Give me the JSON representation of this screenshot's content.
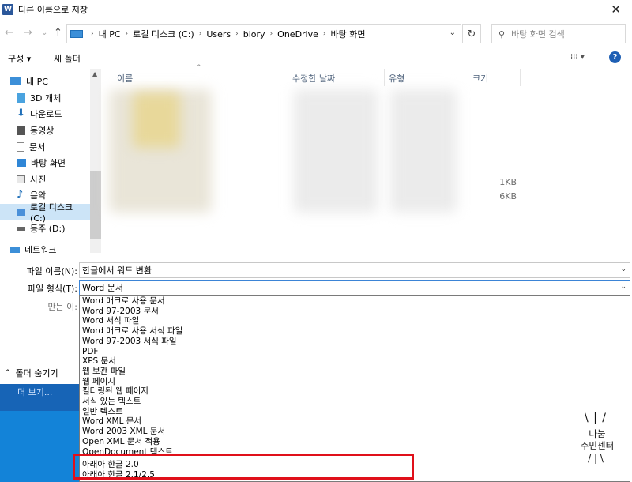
{
  "window": {
    "title": "다른 이름으로 저장",
    "app_icon": "W",
    "close": "✕"
  },
  "nav": {
    "back": "←",
    "forward": "→",
    "recent": "⌄",
    "up": "↑"
  },
  "address": {
    "crumbs": [
      "내 PC",
      "로컬 디스크 (C:)",
      "Users",
      "blory",
      "OneDrive",
      "바탕 화면"
    ],
    "dropdown": "⌄",
    "refresh": "↻"
  },
  "search": {
    "placeholder": "바탕 화면 검색"
  },
  "toolbar": {
    "organize": "구성 ▾",
    "new_folder": "새 폴더",
    "view": "⁞⁞⁞ ▾",
    "help": "?"
  },
  "sidebar": {
    "items": [
      {
        "label": "내 PC",
        "icon": "pc-icon",
        "color": "#3c8fd8"
      },
      {
        "label": "3D 개체",
        "icon": "cube-icon",
        "color": "#4aa3df"
      },
      {
        "label": "다운로드",
        "icon": "download-icon",
        "color": "#1f6fb8"
      },
      {
        "label": "동영상",
        "icon": "video-icon",
        "color": "#555555"
      },
      {
        "label": "문서",
        "icon": "document-icon",
        "color": "#888888"
      },
      {
        "label": "바탕 화면",
        "icon": "desktop-icon",
        "color": "#2f86d6"
      },
      {
        "label": "사진",
        "icon": "picture-icon",
        "color": "#777777"
      },
      {
        "label": "음악",
        "icon": "music-icon",
        "color": "#1f6fb8"
      },
      {
        "label": "로컬 디스크 (C:)",
        "icon": "drive-c-icon",
        "color": "#4a90d9"
      },
      {
        "label": "등주 (D:)",
        "icon": "drive-d-icon",
        "color": "#666666"
      },
      {
        "label": "네트워크",
        "icon": "network-icon",
        "color": "#3c8fd8"
      }
    ]
  },
  "filelist": {
    "columns": {
      "name": "이름",
      "modified": "수정한 날짜",
      "type": "유형",
      "size": "크기"
    },
    "sizes": [
      "1KB",
      "6KB"
    ]
  },
  "form": {
    "filename_label": "파일 이름(N):",
    "filename_value": "한글에서 워드 변환",
    "filetype_label": "파일 형식(T):",
    "filetype_value": "Word 문서",
    "author_label": "만든 이:"
  },
  "hide_folders": "폴더 숨기기",
  "desktop_text": "더 보기...",
  "filetype_options": [
    "Word 매크로 사용 문서",
    "Word 97-2003 문서",
    "Word 서식 파일",
    "Word 매크로 사용 서식 파일",
    "Word 97-2003 서식 파일",
    "PDF",
    "XPS 문서",
    "웹 보관 파일",
    "웹 페이지",
    "필터링된 웹 페이지",
    "서식 있는 텍스트",
    "일반 텍스트",
    "Word XML 문서",
    "Word 2003 XML 문서",
    "Open XML 문서 적용",
    "OpenDocument 텍스트",
    "아래아 한글 2.0",
    "아래아 한글 2.1/2.5"
  ],
  "watermark": {
    "line1": "나눔",
    "line2": "주민센터"
  },
  "colors": {
    "highlight": "#e0101a",
    "selection": "#cce4f7",
    "accent": "#1e5fb4"
  }
}
